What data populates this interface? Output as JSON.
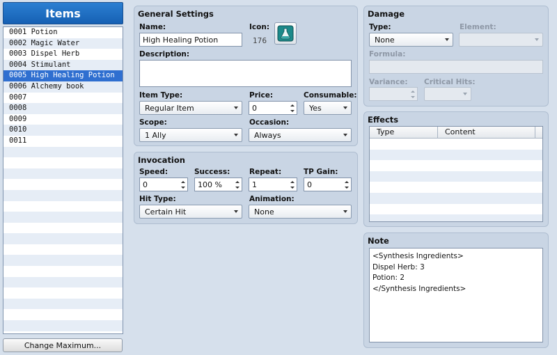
{
  "list": {
    "title": "Items",
    "items": [
      "0001 Potion",
      "0002 Magic Water",
      "0003 Dispel Herb",
      "0004 Stimulant",
      "0005 High Healing Potion",
      "0006 Alchemy book",
      "0007",
      "0008",
      "0009",
      "0010",
      "0011"
    ],
    "selected_index": 4,
    "change_max_label": "Change Maximum..."
  },
  "general": {
    "title": "General Settings",
    "name_label": "Name:",
    "name_value": "High Healing Potion",
    "icon_label": "Icon:",
    "icon_index": "176",
    "description_label": "Description:",
    "description_value": "",
    "item_type_label": "Item Type:",
    "item_type_value": "Regular Item",
    "price_label": "Price:",
    "price_value": "0",
    "consumable_label": "Consumable:",
    "consumable_value": "Yes",
    "scope_label": "Scope:",
    "scope_value": "1 Ally",
    "occasion_label": "Occasion:",
    "occasion_value": "Always"
  },
  "invocation": {
    "title": "Invocation",
    "speed_label": "Speed:",
    "speed_value": "0",
    "success_label": "Success:",
    "success_value": "100 %",
    "repeat_label": "Repeat:",
    "repeat_value": "1",
    "tp_gain_label": "TP Gain:",
    "tp_gain_value": "0",
    "hit_type_label": "Hit Type:",
    "hit_type_value": "Certain Hit",
    "animation_label": "Animation:",
    "animation_value": "None"
  },
  "damage": {
    "title": "Damage",
    "type_label": "Type:",
    "type_value": "None",
    "element_label": "Element:",
    "element_value": "",
    "formula_label": "Formula:",
    "formula_value": "",
    "variance_label": "Variance:",
    "variance_value": "",
    "critical_label": "Critical Hits:",
    "critical_value": ""
  },
  "effects": {
    "title": "Effects",
    "columns": [
      "Type",
      "Content"
    ]
  },
  "note": {
    "title": "Note",
    "text": "<Synthesis Ingredients>\nDispel Herb: 3\nPotion: 2\n</Synthesis Ingredients>"
  },
  "colors": {
    "selection": "#2f6fd0",
    "title_bar": "#1660b4",
    "panel": "#c9d5e4",
    "background": "#d6e0ec"
  },
  "icon": "potion-flask-icon"
}
